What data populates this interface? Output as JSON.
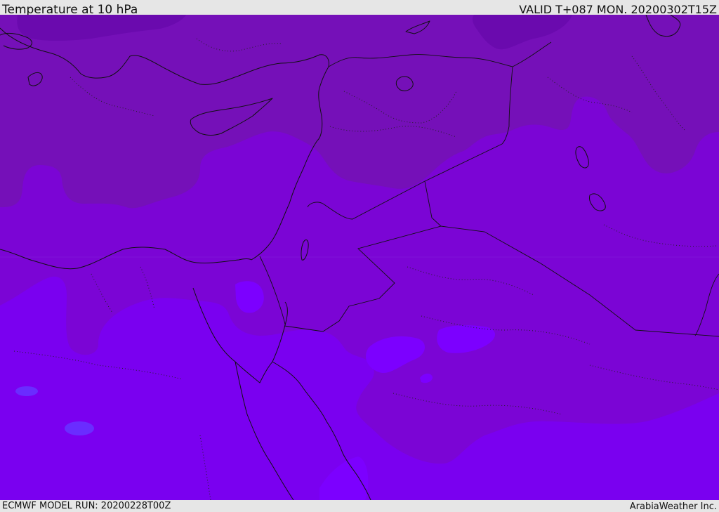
{
  "header": {
    "title": "Temperature at 10 hPa",
    "valid": "VALID T+087 MON. 20200302T15Z"
  },
  "footer": {
    "model_run": "ECMWF MODEL RUN: 20200228T00Z",
    "credit": "ArabiaWeather Inc."
  },
  "map": {
    "layers": [
      {
        "name": "coldest-band",
        "color": "#6a0aae"
      },
      {
        "name": "cold-band",
        "color": "#7510b8"
      },
      {
        "name": "mid-band",
        "color": "#7b05d5"
      },
      {
        "name": "warm-band",
        "color": "#7a00f0"
      },
      {
        "name": "warmest-spot",
        "color": "#7c00ff"
      },
      {
        "name": "pocket-spot",
        "color": "#6a2cff"
      }
    ],
    "coastline_color": "#111111"
  }
}
